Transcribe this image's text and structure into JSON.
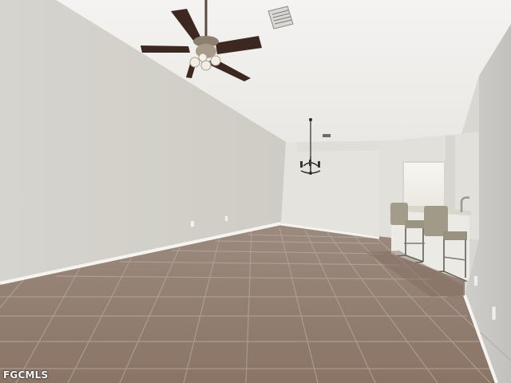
{
  "watermark": {
    "text": "FGCMLS"
  },
  "colors": {
    "wall_left": "#d3d1cb",
    "wall_back": "#e6e4de",
    "ceiling": "#f0efec",
    "wall_right": "#c9c8c4",
    "floor_tile": "#8f7a6c",
    "grout": "#a79b92",
    "baseboard": "#f4f3ef",
    "fan_blade": "#3d2721"
  },
  "icons": {
    "ceiling_fan": "ceiling-fan-icon",
    "chandelier": "chandelier-icon",
    "air_vent": "air-vent-icon"
  }
}
